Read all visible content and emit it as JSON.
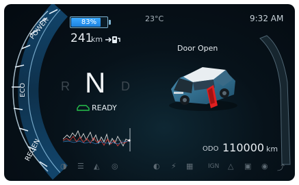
{
  "status_bar": {
    "temperature": "23°C",
    "time": "9:32 AM"
  },
  "battery": {
    "percent_label": "83%",
    "level": 0.83,
    "range_value": "241",
    "range_unit": "km",
    "charge_icon": "plug-charge-icon"
  },
  "power_gauge": {
    "labels": [
      "POWER",
      "ECO",
      "REGEN"
    ],
    "colors": {
      "scale": "#8fd2f5",
      "accent": "#2f8fd6"
    }
  },
  "gear_selector": {
    "reverse": "R",
    "current": "N",
    "drive": "D"
  },
  "drive_status": {
    "label": "READY",
    "icon": "car-icon",
    "color": "#27c24c"
  },
  "vehicle": {
    "alert": "Door Open"
  },
  "odometer": {
    "label": "ODO",
    "value": "110000",
    "unit": "km"
  },
  "telltales": [
    "high-beam-icon",
    "fog-light-icon",
    "parking-icon",
    "brake-icon",
    "headlamp-icon",
    "plug-icon",
    "charge-station-icon",
    "ign-text-icon",
    "warning-triangle-icon",
    "engine-icon",
    "tpms-icon",
    "wrench-icon"
  ],
  "telltale_text": {
    "ign": "IGN"
  }
}
